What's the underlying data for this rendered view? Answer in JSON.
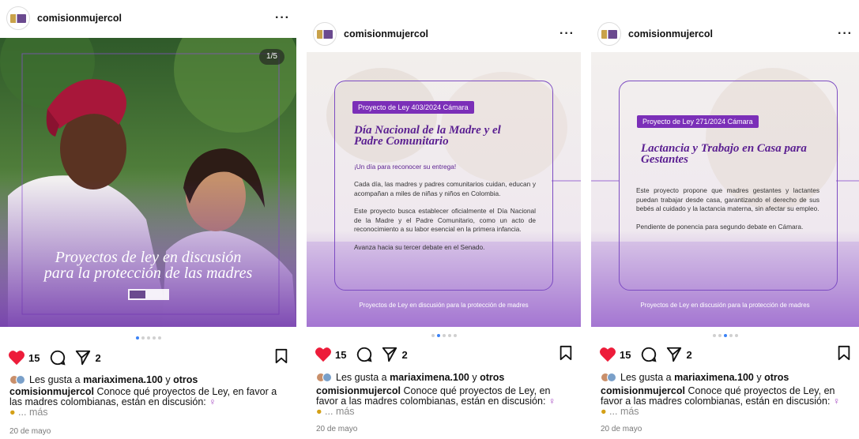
{
  "posts": [
    {
      "username": "comisionmujercol",
      "slide_counter": "1/5",
      "banner_line1": "Proyectos de ley en discusión",
      "banner_line2": "para la protección de las madres",
      "likes_count": "15",
      "shares_count": "2",
      "liked_by_prefix": "Les gusta a ",
      "liked_by_user": "mariaximena.100",
      "liked_by_join": " y ",
      "liked_by_others": "otros",
      "caption_user": "comisionmujercol",
      "caption_text": "Conoce qué proyectos de Ley, en favor a las madres colombianas, están en discusión:",
      "caption_more": "... más",
      "date": "20 de mayo",
      "active_dot": 0
    },
    {
      "username": "comisionmujercol",
      "pill": "Proyecto de Ley 403/2024 Cámara",
      "title": "Día Nacional de la Madre y el Padre Comunitario",
      "subtitle": "¡Un día para reconocer su entrega!",
      "paragraphs": [
        "Cada día, las madres y padres comunitarios cuidan, educan y acompañan a miles de niñas y niños en Colombia.",
        "Este proyecto busca establecer oficialmente el Día Nacional de la Madre y el Padre Comunitario, como un acto de reconocimiento a su labor esencial en la primera infancia.",
        "Avanza hacia su tercer debate en el Senado."
      ],
      "tagline": "Proyectos de Ley en discusión para la protección de madres",
      "likes_count": "15",
      "shares_count": "2",
      "liked_by_prefix": "Les gusta a ",
      "liked_by_user": "mariaximena.100",
      "liked_by_join": " y ",
      "liked_by_others": "otros",
      "caption_user": "comisionmujercol",
      "caption_text": "Conoce qué proyectos de Ley, en favor a las madres colombianas, están en discusión:",
      "caption_more": "... más",
      "date": "20 de mayo",
      "active_dot": 1
    },
    {
      "username": "comisionmujercol",
      "pill": "Proyecto de Ley 271/2024 Cámara",
      "title": "Lactancia y Trabajo en Casa para Gestantes",
      "paragraphs": [
        "Este proyecto propone que madres gestantes y lactantes puedan trabajar desde casa, garantizando el derecho de sus bebés al cuidado y la lactancia materna, sin afectar su empleo.",
        "Pendiente de ponencia para segundo debate en Cámara."
      ],
      "tagline": "Proyectos de Ley en discusión para la protección de madres",
      "likes_count": "15",
      "shares_count": "2",
      "liked_by_prefix": "Les gusta a ",
      "liked_by_user": "mariaximena.100",
      "liked_by_join": " y ",
      "liked_by_others": "otros",
      "caption_user": "comisionmujercol",
      "caption_text": "Conoce qué proyectos de Ley, en favor a las madres colombianas, están en discusión:",
      "caption_more": "... más",
      "date": "20 de mayo",
      "active_dot": 2
    }
  ],
  "colors": {
    "accent_purple": "#7b2fb8",
    "like_red": "#ed1c3a",
    "dot_active": "#3b82f6"
  },
  "icons": [
    "heart-icon",
    "comment-icon",
    "share-icon",
    "bookmark-icon",
    "more-options-icon"
  ]
}
